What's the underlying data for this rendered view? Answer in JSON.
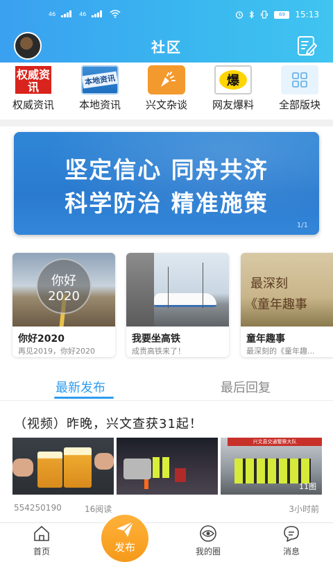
{
  "status_bar": {
    "network_left": "46",
    "network_right": "46",
    "battery": "69",
    "time": "15:13"
  },
  "header": {
    "title": "社区"
  },
  "categories": [
    {
      "label": "权威资讯",
      "icon_text": "权威资讯",
      "icon": "authority-news-icon"
    },
    {
      "label": "本地资讯",
      "icon_text": "本地资讯",
      "icon": "local-news-icon"
    },
    {
      "label": "兴文杂谈",
      "icon_text": "",
      "icon": "chat-icon"
    },
    {
      "label": "网友爆料",
      "icon_text": "爆",
      "icon": "tipoff-icon"
    },
    {
      "label": "全部版块",
      "icon_text": "",
      "icon": "grid-icon"
    }
  ],
  "banner": {
    "line1": "坚定信心 同舟共济",
    "line2": "科学防治 精准施策",
    "counter": "1/1"
  },
  "cards": [
    {
      "title": "你好2020",
      "subtitle": "再见2019，你好2020",
      "image_text_1": "你好",
      "image_text_2": "2020"
    },
    {
      "title": "我要坐高铁",
      "subtitle": "成贵高铁来了！",
      "image_text_1": "",
      "image_text_2": ""
    },
    {
      "title": "童年趣事",
      "subtitle": "最深刻的《童年趣...",
      "image_text_1": "最深刻",
      "image_text_2": "《童年趣事"
    }
  ],
  "tabs": {
    "latest": "最新发布",
    "last_reply": "最后回复"
  },
  "post": {
    "title": "（视频）昨晚，兴文查获31起！",
    "image_count": "11图",
    "author": "554250190",
    "reads": "16阅读",
    "time": "3小时前",
    "sign_text": "兴文县交通警察大队"
  },
  "bottom_nav": {
    "home": "首页",
    "publish": "发布",
    "my_circle": "我的圈",
    "messages": "消息"
  },
  "colors": {
    "accent": "#2d9cf0",
    "header_gradient_start": "#3aa0f0",
    "header_gradient_end": "#40c4f0",
    "publish_orange": "#f59a1a",
    "banner_blue": "#2a7bd0"
  }
}
